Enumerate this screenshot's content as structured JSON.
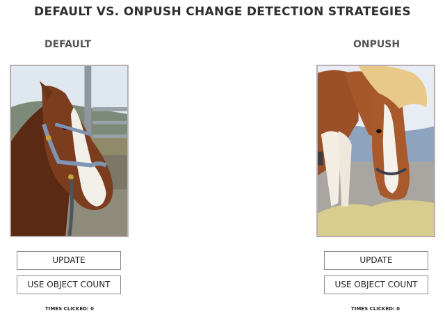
{
  "title": "DEFAULT VS. ONPUSH CHANGE DETECTION STRATEGIES",
  "panels": {
    "default": {
      "heading": "DEFAULT",
      "image_alt": "brown and white horse wearing a blue halter",
      "update_label": "UPDATE",
      "count_label": "USE OBJECT COUNT",
      "times_clicked_label": "TIMES CLICKED:",
      "times_clicked_value": "0"
    },
    "onpush": {
      "heading": "ONPUSH",
      "image_alt": "light brown horse with blond mane eating hay",
      "update_label": "UPDATE",
      "count_label": "USE OBJECT COUNT",
      "times_clicked_label": "TIMES CLICKED:",
      "times_clicked_value": "0"
    }
  },
  "colors": {
    "frame_border": "#b9aeb4",
    "button_border": "#8a8a8a",
    "title_text": "#2f2f2f",
    "heading_text": "#555555"
  }
}
